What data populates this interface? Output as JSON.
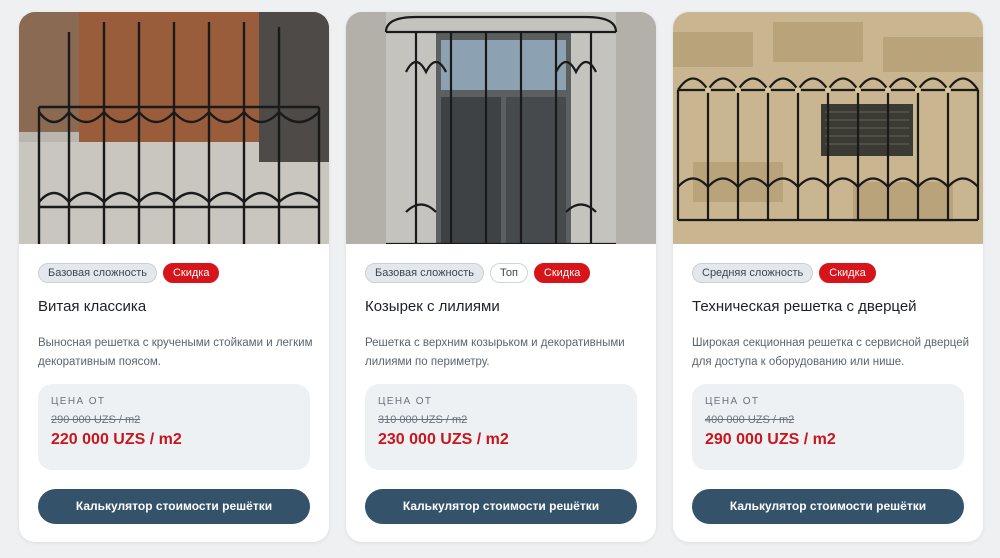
{
  "cards": [
    {
      "badges": [
        "Базовая сложность",
        "Скидка"
      ],
      "title": "Витая классика",
      "description": "Выносная решетка с кручеными стойками и легким декоративным поясом.",
      "price_label": "ЦЕНА ОТ",
      "old_price": "290 000 UZS / m2",
      "new_price": "220 000 UZS / m2",
      "button": "Калькулятор стоимости решётки"
    },
    {
      "badges": [
        "Базовая сложность",
        "Топ",
        "Скидка"
      ],
      "title": "Козырек с лилиями",
      "description": "Решетка с верхним козырьком и декоративными лилиями по периметру.",
      "price_label": "ЦЕНА ОТ",
      "old_price": "310 000 UZS / m2",
      "new_price": "230 000 UZS / m2",
      "button": "Калькулятор стоимости решётки"
    },
    {
      "badges": [
        "Средняя сложность",
        "Скидка"
      ],
      "title": "Техническая решетка с дверцей",
      "description": "Широкая секционная решетка с сервисной дверцей для доступа к оборудованию или нише.",
      "price_label": "ЦЕНА ОТ",
      "old_price": "400 000 UZS / m2",
      "new_price": "290 000 UZS / m2",
      "button": "Калькулятор стоимости решётки"
    }
  ],
  "colors": {
    "accent_red": "#d7141a",
    "price_red": "#c8161c",
    "button_bg": "#34536b",
    "page_bg": "#eef0f2"
  }
}
